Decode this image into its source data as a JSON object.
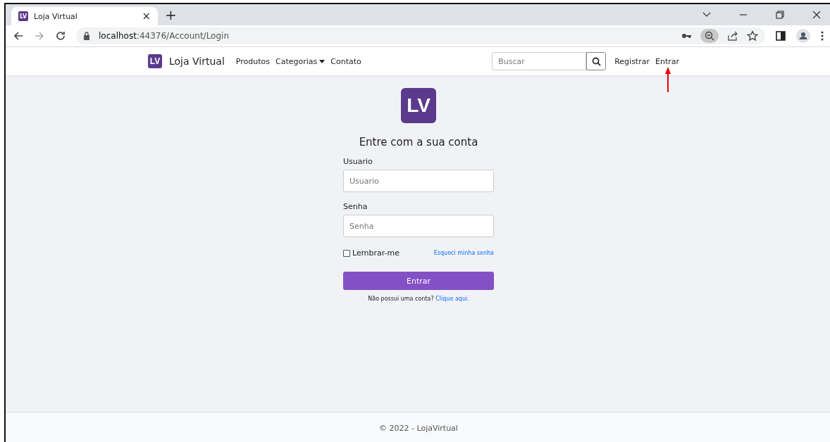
{
  "browser": {
    "tabs": [
      {
        "icon_text": "LV",
        "title": "Loja Virtual",
        "selected": true
      }
    ],
    "close_symbol": "×",
    "new_tab_symbol": "+",
    "address": {
      "host": "localhost",
      "path": ":44376/Account/Login"
    }
  },
  "navbar": {
    "logo_text": "LV",
    "brand": "Loja Virtual",
    "links": [
      {
        "label": "Produtos",
        "dropdown": false
      },
      {
        "label": "Categorias",
        "dropdown": true
      },
      {
        "label": "Contato",
        "dropdown": false
      }
    ],
    "search": {
      "placeholder": "Buscar"
    },
    "actions": [
      "Registrar",
      "Entrar"
    ]
  },
  "login": {
    "logo_text": "LV",
    "heading": "Entre com a sua conta",
    "fields": [
      {
        "label": "Usuario",
        "placeholder": "Usuario"
      },
      {
        "label": "Senha",
        "placeholder": "Senha"
      }
    ],
    "remember": {
      "label": "Lembrar-me",
      "checked": false
    },
    "forgot_link": "Esqueci minha senha",
    "submit": "Entrar",
    "signup_text": "Não possui uma conta?",
    "signup_link": "Clique aqui."
  },
  "footer": {
    "text": "© 2022 - LojaVirtual"
  }
}
